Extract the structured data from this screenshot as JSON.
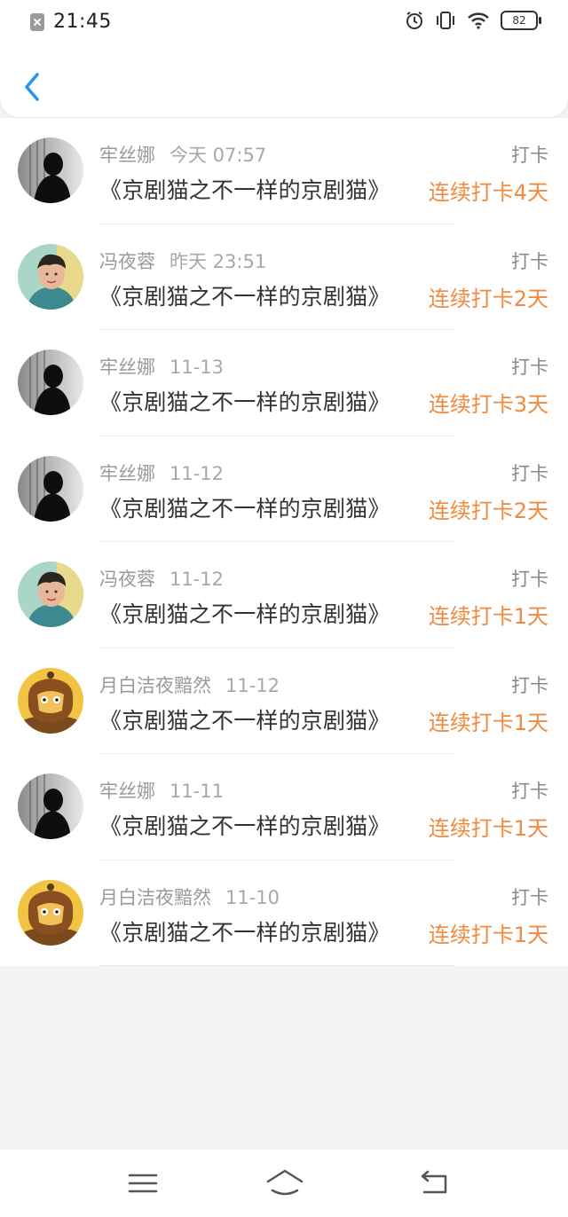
{
  "status_bar": {
    "time": "21:45",
    "battery": "82",
    "icons": [
      "notification-off-icon",
      "alarm-icon",
      "vibrate-icon",
      "wifi-icon",
      "battery-icon"
    ]
  },
  "header": {
    "back_icon": "chevron-left-icon",
    "accent_color": "#2196f3"
  },
  "colors": {
    "streak": "#f08a3e",
    "meta": "#9a9a9a",
    "title": "#333333"
  },
  "list": [
    {
      "user": "牢丝娜",
      "time": "今天 07:57",
      "action": "打卡",
      "title": "《京剧猫之不一样的京剧猫》",
      "streak": "连续打卡4天",
      "avatar": "dark-silhouette"
    },
    {
      "user": "冯夜蓉",
      "time": "昨天 23:51",
      "action": "打卡",
      "title": "《京剧猫之不一样的京剧猫》",
      "streak": "连续打卡2天",
      "avatar": "boy-photo"
    },
    {
      "user": "牢丝娜",
      "time": "11-13",
      "action": "打卡",
      "title": "《京剧猫之不一样的京剧猫》",
      "streak": "连续打卡3天",
      "avatar": "dark-silhouette"
    },
    {
      "user": "牢丝娜",
      "time": "11-12",
      "action": "打卡",
      "title": "《京剧猫之不一样的京剧猫》",
      "streak": "连续打卡2天",
      "avatar": "dark-silhouette"
    },
    {
      "user": "冯夜蓉",
      "time": "11-12",
      "action": "打卡",
      "title": "《京剧猫之不一样的京剧猫》",
      "streak": "连续打卡1天",
      "avatar": "boy-photo"
    },
    {
      "user": "月白洁夜黯然",
      "time": "11-12",
      "action": "打卡",
      "title": "《京剧猫之不一样的京剧猫》",
      "streak": "连续打卡1天",
      "avatar": "cartoon-cat"
    },
    {
      "user": "牢丝娜",
      "time": "11-11",
      "action": "打卡",
      "title": "《京剧猫之不一样的京剧猫》",
      "streak": "连续打卡1天",
      "avatar": "dark-silhouette"
    },
    {
      "user": "月白洁夜黯然",
      "time": "11-10",
      "action": "打卡",
      "title": "《京剧猫之不一样的京剧猫》",
      "streak": "连续打卡1天",
      "avatar": "cartoon-cat"
    }
  ],
  "navbar": {
    "icons": [
      "menu-icon",
      "home-icon",
      "back-nav-icon"
    ]
  }
}
